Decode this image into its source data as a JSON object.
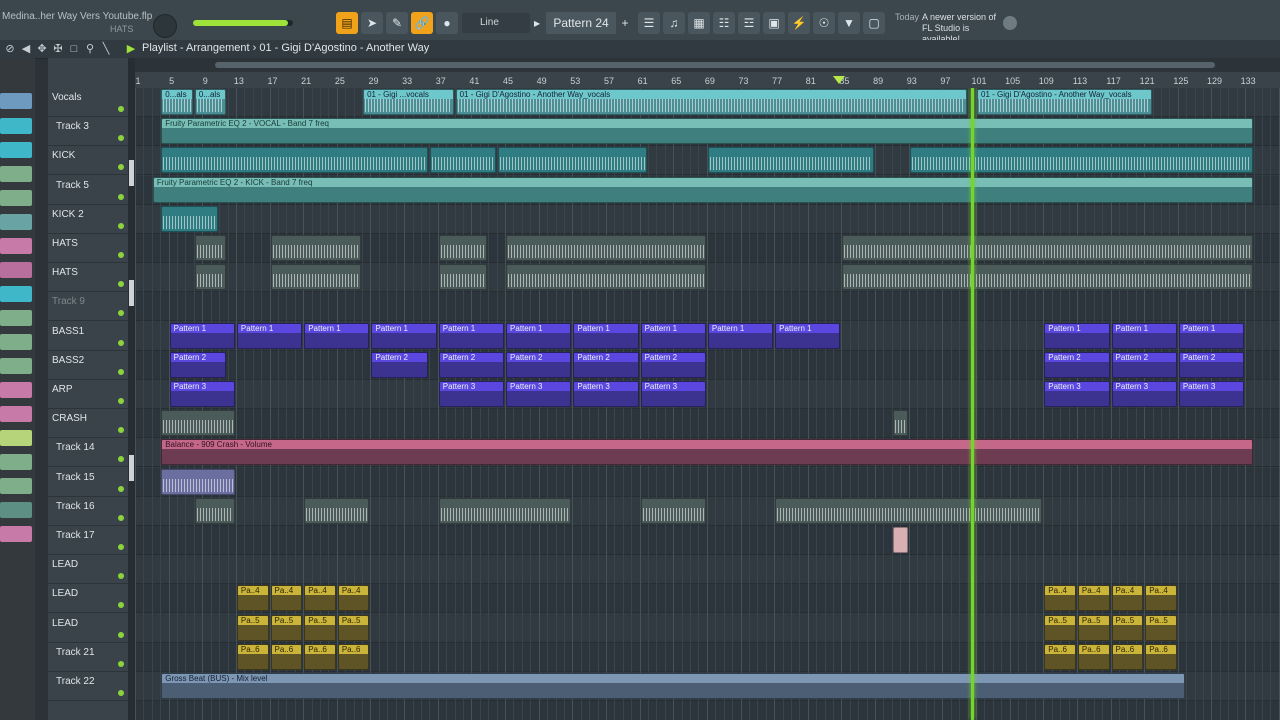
{
  "toolbar": {
    "project_name": "Medina..her Way Vers Youtube.flp",
    "project_sub": "HATS",
    "line_mode": "Line",
    "pattern": "Pattern 24",
    "news_date": "Today",
    "news_text": "A newer version of FL Studio is available!",
    "master_level": 0.95
  },
  "playlist": {
    "title": "Playlist - Arrangement › 01 - Gigi D'Agostino - Another Way"
  },
  "ruler": {
    "bars": [
      "1",
      "5",
      "9",
      "13",
      "17",
      "21",
      "25",
      "29",
      "33",
      "37",
      "41",
      "45",
      "49",
      "53",
      "57",
      "61",
      "65",
      "69",
      "73",
      "77",
      "81",
      "85",
      "89",
      "93",
      "97",
      "101",
      "105",
      "109",
      "113",
      "117",
      "121",
      "125",
      "129",
      "133"
    ]
  },
  "tracks": [
    {
      "name": "Vocals"
    },
    {
      "name": "Track 3"
    },
    {
      "name": "KICK"
    },
    {
      "name": "Track 5"
    },
    {
      "name": "KICK 2"
    },
    {
      "name": "HATS"
    },
    {
      "name": "HATS"
    },
    {
      "name": "Track 9"
    },
    {
      "name": "BASS1"
    },
    {
      "name": "BASS2"
    },
    {
      "name": "ARP"
    },
    {
      "name": "CRASH"
    },
    {
      "name": "Track 14"
    },
    {
      "name": "Track 15"
    },
    {
      "name": "Track 16"
    },
    {
      "name": "Track 17"
    },
    {
      "name": "LEAD"
    },
    {
      "name": "LEAD"
    },
    {
      "name": "LEAD"
    },
    {
      "name": "Track 21"
    },
    {
      "name": "Track 22"
    }
  ],
  "clip_labels": {
    "vocal_small": "0...als",
    "vocal_a": "01 - Gigi ...vocals",
    "vocal_b": "01 - Gigi D'Agostino - Another Way_vocals",
    "eq_vocal": "Fruity Parametric EQ 2 - VOCAL - Band 7 freq",
    "eq_kick": "Fruity Parametric EQ 2 - KICK - Band 7 freq",
    "pattern1": "Pattern 1",
    "pattern2": "Pattern 2",
    "pattern3": "Pattern 3",
    "balance": "Balance - 909 Crash - Volume",
    "pa4": "Pa..4",
    "pa5": "Pa..5",
    "pa6": "Pa..6",
    "grossbeat": "Gross Beat (BUS) - Mix level"
  },
  "colors": {
    "accent": "#f0a21b",
    "playhead": "#74d52b",
    "pattern": "#5b47e0",
    "vocal": "#6ec7cb"
  }
}
